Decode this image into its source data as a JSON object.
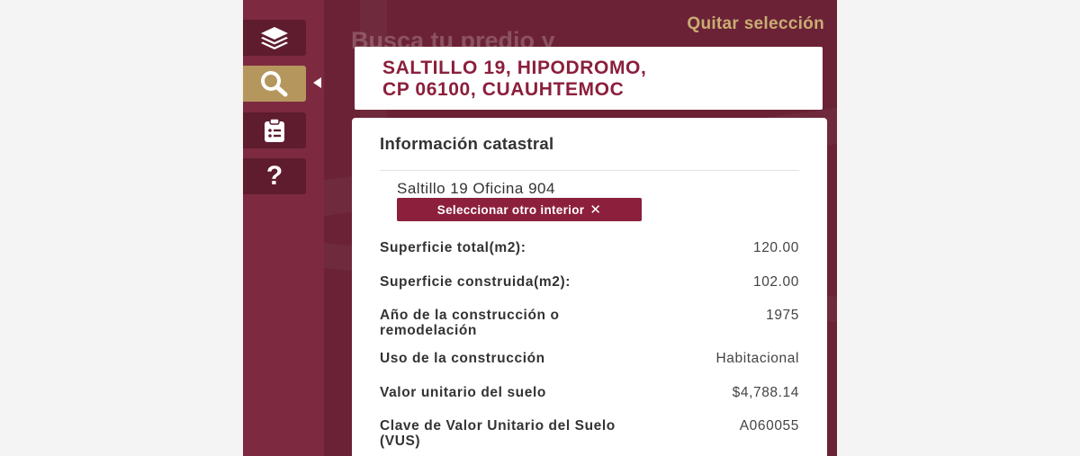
{
  "sidebar": {
    "buttons": [
      {
        "icon": "layers-icon"
      },
      {
        "icon": "search-icon",
        "active": true
      },
      {
        "icon": "clipboard-list-icon"
      },
      {
        "icon": "question-icon",
        "glyph": "?"
      }
    ]
  },
  "map": {
    "ghost_title": "Busca tu predio y",
    "clear_selection": "Quitar selección"
  },
  "address": {
    "line1": "SALTILLO 19, HIPODROMO,",
    "line2": "CP 06100, CUAUHTEMOC"
  },
  "info": {
    "title": "Información catastral",
    "interior_name": "Saltillo 19 Oficina 904",
    "other_interior_label": "Seleccionar otro interior",
    "other_interior_icon": "✕",
    "rows": [
      {
        "label": "Superficie total(m2):",
        "value": "120.00"
      },
      {
        "label": "Superficie construida(m2):",
        "value": "102.00"
      },
      {
        "label": "Año de la construcción o remodelación",
        "value": "1975"
      },
      {
        "label": "Uso de la construcción",
        "value": "Habitacional"
      },
      {
        "label": "Valor unitario del suelo",
        "value": "$4,788.14"
      },
      {
        "label": "Clave de Valor Unitario del Suelo (VUS)",
        "value": "A060055"
      }
    ]
  },
  "colors": {
    "brand": "#8b1f3c",
    "accent": "#b5975e",
    "sidebar": "#7d2a40"
  }
}
